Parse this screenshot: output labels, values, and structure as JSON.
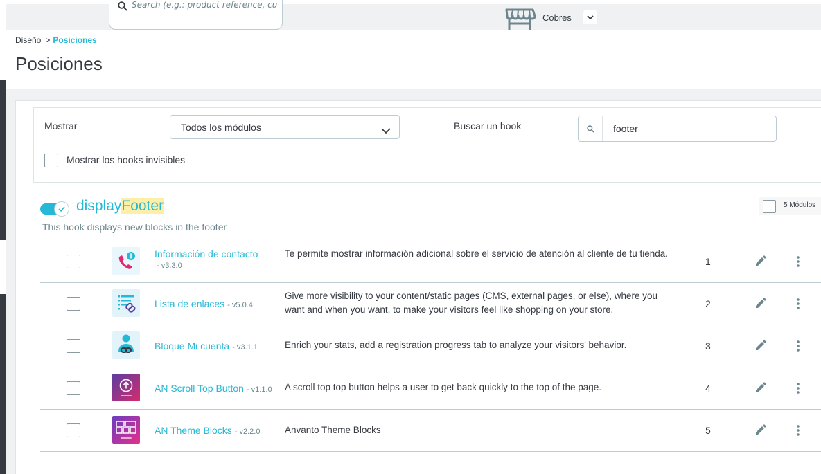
{
  "header": {
    "search_placeholder": "Search (e.g.: product reference, custon",
    "shop_name": "Cobres"
  },
  "breadcrumb": {
    "parent": "Diseño",
    "separator": ">",
    "current": "Posiciones"
  },
  "page_title": "Posiciones",
  "filters": {
    "show_label": "Mostrar",
    "show_value": "Todos los módulos",
    "search_hook_label": "Buscar un hook",
    "search_hook_value": "footer",
    "invisible_hooks_label": "Mostrar los hooks invisibles"
  },
  "hook": {
    "name_prefix": "display",
    "name_match": "Footer",
    "description": "This hook displays new blocks in the footer",
    "module_count": "5 Módulos"
  },
  "modules": [
    {
      "name": "Información de contacto",
      "version": "- v3.3.0",
      "description": "Te permite mostrar información adicional sobre el servicio de atención al cliente de tu tienda.",
      "position": "1"
    },
    {
      "name": "Lista de enlaces",
      "version": "- v5.0.4",
      "description": "Give more visibility to your content/static pages (CMS, external pages, or else), where you want and when you want, to make your visitors feel like shopping on your store.",
      "position": "2"
    },
    {
      "name": "Bloque Mi cuenta",
      "version": "- v3.1.1",
      "description": "Enrich your stats, add a registration progress tab to analyze your visitors' behavior.",
      "position": "3"
    },
    {
      "name": "AN Scroll Top Button",
      "version": "- v1.1.0",
      "description": "A scroll top top button helps a user to get back quickly to the top of the page.",
      "position": "4"
    },
    {
      "name": "AN Theme Blocks",
      "version": "- v2.2.0",
      "description": "Anvanto Theme Blocks",
      "position": "5"
    }
  ],
  "colors": {
    "accent": "#25b9d7",
    "highlight": "#fdefa8",
    "text": "#363a41",
    "muted": "#6c868e"
  }
}
